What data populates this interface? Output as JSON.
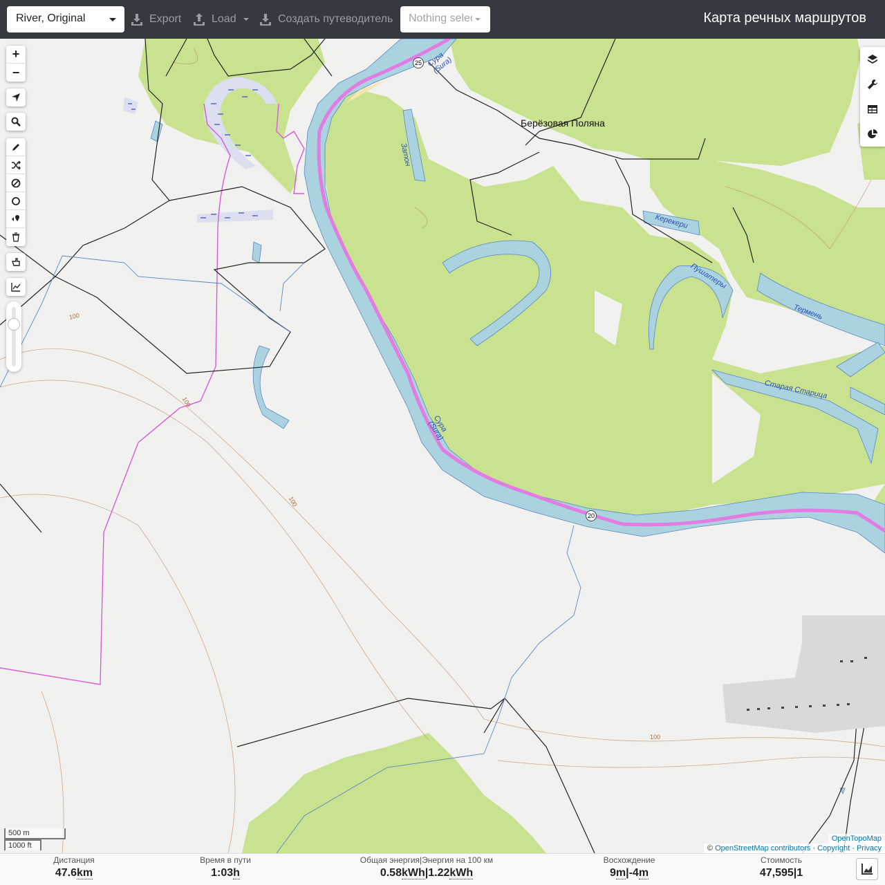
{
  "topbar": {
    "profile": "River, Original",
    "export_label": "Export",
    "load_label": "Load",
    "guide_label": "Создать путеводитель",
    "select_placeholder": "Nothing selected",
    "brand": "Карта речных маршрутов"
  },
  "map": {
    "labels": {
      "village": "Берёзовая Поляна",
      "sura_top_1": "Сура",
      "sura_top_2": "(Sura)",
      "sura_mid_1": "Сура",
      "sura_mid_2": "(Sura)",
      "zaton": "Затон",
      "kerekeri": "Керекери",
      "pushatery": "Пушатеры",
      "termen": "Термень",
      "staraya": "Старая Старица"
    },
    "shields": {
      "a": "25",
      "b": "20"
    },
    "contours": {
      "c1": "100",
      "c2": "100",
      "c3": "100",
      "c4": "100"
    },
    "scale": {
      "metric": "500 m",
      "imperial": "1000 ft"
    },
    "attribution": {
      "layer": "OpenTopoMap",
      "copy": "©",
      "osm": "OpenStreetMap contributors",
      "sep1": "·",
      "copyright": "Copyright",
      "sep2": "·",
      "privacy": "Privacy"
    },
    "zoom_in": "+",
    "zoom_out": "−"
  },
  "stats": {
    "distance": {
      "label": "Дистанция",
      "value": "47.6",
      "unit": "km"
    },
    "time": {
      "label": "Время в пути",
      "value": "1:03",
      "unit": "h"
    },
    "energy": {
      "label": "Общая энергия|Энергия на 100 км",
      "v1": "0.58",
      "u1": "kWh",
      "sep": "|",
      "v2": "1.22",
      "u2": "kWh"
    },
    "ascent": {
      "label": "Восхождение",
      "v1": "9",
      "u1": "m",
      "sep": "|",
      "v2": "-4",
      "u2": "m"
    },
    "cost": {
      "label": "Стоимость",
      "v1": "47,595",
      "sep": "|",
      "v2": "1"
    }
  },
  "colors": {
    "water": "#aad3df",
    "forest": "#c8e28f",
    "route": "#d85ad8",
    "topbar": "#343a40"
  }
}
